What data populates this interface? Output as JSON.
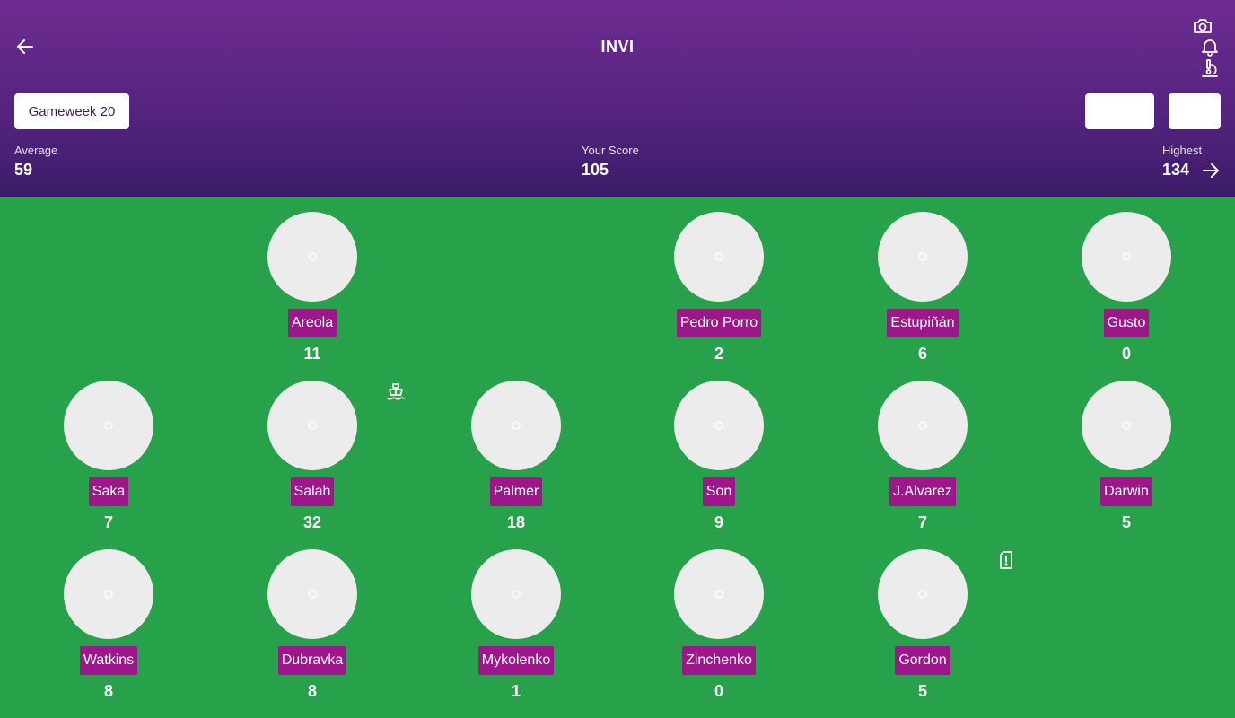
{
  "header": {
    "title": "INVI",
    "gameweek_label": "Gameweek 20",
    "average_label": "Average",
    "average_value": "59",
    "your_score_label": "Your Score",
    "your_score_value": "105",
    "highest_label": "Highest",
    "highest_value": "134",
    "icons": [
      "back-arrow-icon",
      "camera-icon",
      "bell-icon",
      "microscope-icon",
      "arrow-right-icon"
    ]
  },
  "pitch": {
    "players": [
      {
        "name": "Areola",
        "points": "11"
      },
      {
        "name": "Pedro Porro",
        "points": "2"
      },
      {
        "name": "Estupiñán",
        "points": "6"
      },
      {
        "name": "Gusto",
        "points": "0"
      },
      {
        "name": "Saka",
        "points": "7"
      },
      {
        "name": "Salah",
        "points": "32"
      },
      {
        "name": "Palmer",
        "points": "18"
      },
      {
        "name": "Son",
        "points": "9"
      },
      {
        "name": "J.Alvarez",
        "points": "7"
      },
      {
        "name": "Darwin",
        "points": "5"
      },
      {
        "name": "Watkins",
        "points": "8"
      },
      {
        "name": "Dubravka",
        "points": "8"
      },
      {
        "name": "Mykolenko",
        "points": "1"
      },
      {
        "name": "Zinchenko",
        "points": "0"
      },
      {
        "name": "Gordon",
        "points": "5"
      }
    ],
    "icons": [
      "ship-icon",
      "alert-file-icon"
    ]
  },
  "colors": {
    "header_top": "#6e2b92",
    "header_bottom": "#3b1c68",
    "pitch": "#27a14a",
    "name_tag": "#9c1789"
  }
}
